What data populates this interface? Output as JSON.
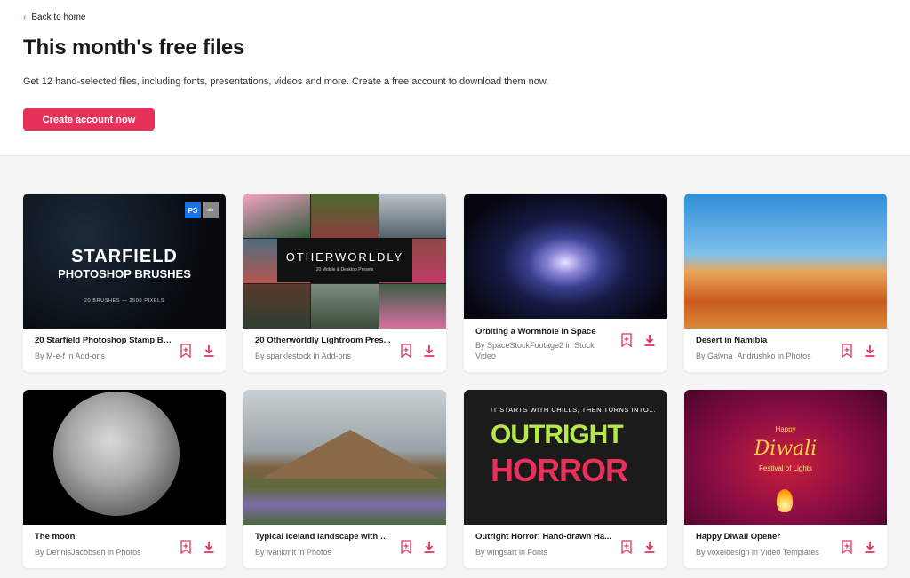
{
  "header": {
    "back_label": "Back to home",
    "title": "This month's free files",
    "subtitle": "Get 12 hand-selected files, including fonts, presentations, videos and more. Create a free account to download them now.",
    "cta_label": "Create account now",
    "accent_color": "#e6325a"
  },
  "cards": [
    {
      "title": "20 Starfield Photoshop Stamp Br...",
      "by": "By M-e-f in Add-ons",
      "thumb_text": {
        "line1": "STARFIELD",
        "line2": "PHOTOSHOP BRUSHES",
        "line3": "20 BRUSHES — 2500 PIXELS",
        "ps": "PS",
        "abr": "abr"
      }
    },
    {
      "title": "20 Otherworldly Lightroom Pres...",
      "by": "By sparklestock in Add-ons",
      "thumb_text": {
        "line1": "OTHERWORLDLY",
        "line2": "20 Mobile & Desktop Presets"
      }
    },
    {
      "title": "Orbiting a Wormhole in Space",
      "by": "By SpaceStockFootage2 in Stock Video"
    },
    {
      "title": "Desert in Namibia",
      "by": "By Galyna_Andrushko in Photos"
    },
    {
      "title": "The moon",
      "by": "By DennisJacobsen in Photos"
    },
    {
      "title": "Typical Iceland landscape with m...",
      "by": "By ivankmit in Photos"
    },
    {
      "title": "Outright Horror: Hand-drawn Ha...",
      "by": "By wingsart in Fonts",
      "thumb_text": {
        "top": "IT STARTS WITH CHILLS, THEN TURNS INTO...",
        "line1": "OUTRIGHT",
        "line2": "HORROR"
      }
    },
    {
      "title": "Happy Diwali Opener",
      "by": "By voxeldesign in Video Templates",
      "thumb_text": {
        "happy": "Happy",
        "main": "Diwali",
        "sub": "Festival of Lights"
      }
    }
  ]
}
